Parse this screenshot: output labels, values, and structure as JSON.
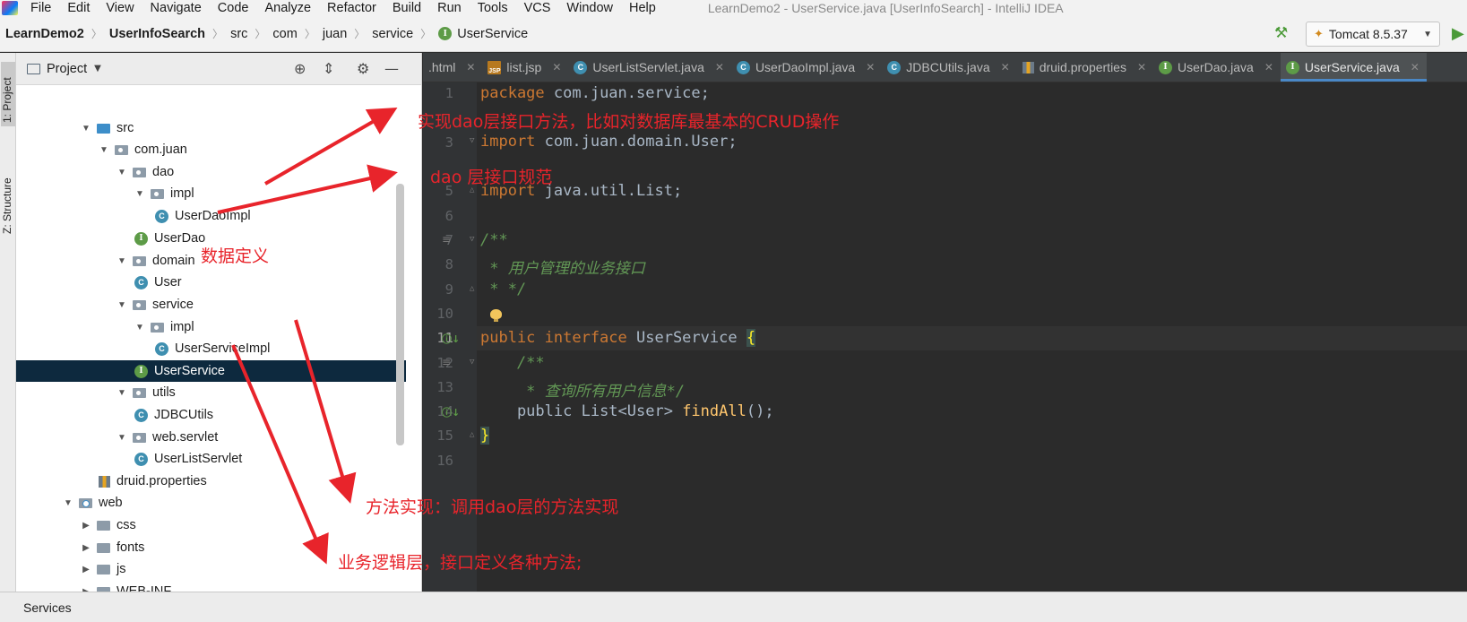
{
  "window": {
    "title": "LearnDemo2 - UserService.java [UserInfoSearch] - IntelliJ IDEA",
    "menu": [
      "File",
      "Edit",
      "View",
      "Navigate",
      "Code",
      "Analyze",
      "Refactor",
      "Build",
      "Run",
      "Tools",
      "VCS",
      "Window",
      "Help"
    ]
  },
  "navbar": {
    "breadcrumbs": [
      "LearnDemo2",
      "UserInfoSearch",
      "src",
      "com",
      "juan",
      "service",
      "UserService"
    ],
    "run_config": "Tomcat 8.5.37"
  },
  "left_strip": {
    "project_tab": "1: Project",
    "structure_tab": "Z: Structure"
  },
  "project_panel": {
    "title": "Project",
    "tree": [
      {
        "label": "src",
        "icon": "src-folder-icon",
        "twisty": "expanded"
      },
      {
        "label": "com.juan",
        "icon": "package-icon",
        "twisty": "expanded"
      },
      {
        "label": "dao",
        "icon": "package-icon",
        "twisty": "expanded"
      },
      {
        "label": "impl",
        "icon": "package-icon",
        "twisty": "expanded"
      },
      {
        "label": "UserDaoImpl",
        "icon": "class-icon",
        "twisty": "none"
      },
      {
        "label": "UserDao",
        "icon": "interface-icon",
        "twisty": "none"
      },
      {
        "label": "domain",
        "icon": "package-icon",
        "twisty": "expanded"
      },
      {
        "label": "User",
        "icon": "class-icon",
        "twisty": "none"
      },
      {
        "label": "service",
        "icon": "package-icon",
        "twisty": "expanded"
      },
      {
        "label": "impl",
        "icon": "package-icon",
        "twisty": "expanded"
      },
      {
        "label": "UserServiceImpl",
        "icon": "class-icon",
        "twisty": "none"
      },
      {
        "label": "UserService",
        "icon": "interface-icon",
        "twisty": "none",
        "selected": true
      },
      {
        "label": "utils",
        "icon": "package-icon",
        "twisty": "expanded"
      },
      {
        "label": "JDBCUtils",
        "icon": "class-icon",
        "twisty": "none"
      },
      {
        "label": "web.servlet",
        "icon": "package-icon",
        "twisty": "expanded"
      },
      {
        "label": "UserListServlet",
        "icon": "class-icon",
        "twisty": "none"
      },
      {
        "label": "druid.properties",
        "icon": "properties-icon",
        "twisty": "none"
      },
      {
        "label": "web",
        "icon": "web-folder-icon",
        "twisty": "expanded"
      },
      {
        "label": "css",
        "icon": "folder-icon",
        "twisty": "collapsed"
      },
      {
        "label": "fonts",
        "icon": "folder-icon",
        "twisty": "collapsed"
      },
      {
        "label": "js",
        "icon": "folder-icon",
        "twisty": "collapsed"
      },
      {
        "label": "WEB-INF",
        "icon": "folder-icon",
        "twisty": "collapsed"
      }
    ]
  },
  "editor": {
    "tabs": [
      {
        "label": ".html",
        "icon": "none"
      },
      {
        "label": "list.jsp",
        "icon": "jsp-icon"
      },
      {
        "label": "UserListServlet.java",
        "icon": "class-icon"
      },
      {
        "label": "UserDaoImpl.java",
        "icon": "class-icon"
      },
      {
        "label": "JDBCUtils.java",
        "icon": "class-icon"
      },
      {
        "label": "druid.properties",
        "icon": "properties-icon"
      },
      {
        "label": "UserDao.java",
        "icon": "interface-icon"
      },
      {
        "label": "UserService.java",
        "icon": "interface-icon",
        "active": true
      }
    ],
    "line_numbers": [
      "1",
      "3",
      "5",
      "6",
      "7",
      "8",
      "9",
      "10",
      "11",
      "12",
      "13",
      "14",
      "15",
      "16"
    ],
    "current_line": "11",
    "code": {
      "l1_kw": "package",
      "l1_rest": " com.juan.service;",
      "l3_kw": "import",
      "l3_rest": " com.juan.domain.User;",
      "l5_kw": "import",
      "l5_rest": " java.util.List;",
      "l7": "/**",
      "l8": " * 用户管理的业务接口",
      "l9": " * */",
      "l11_kw": "public interface",
      "l11_name": " UserService ",
      "l11_brace": "{",
      "l12": "    /**",
      "l13": "     * 查询所有用户信息*/",
      "l14_kw": "    public",
      "l14_type": " List<User> ",
      "l14_fn": "findAll",
      "l14_end": "();",
      "l15": "}"
    }
  },
  "bottom_bar": {
    "services": "Services"
  },
  "annotations": {
    "dao_impl": "实现dao层接口方法，比如对数据库最基本的CRUD操作",
    "dao_spec": "dao 层接口规范",
    "data_def": "数据定义",
    "method_impl": "方法实现：调用dao层的方法实现",
    "business": "业务逻辑层，接口定义各种方法;"
  },
  "colors": {
    "annotation_red": "#e8242b",
    "selection": "#0d293e",
    "keyword": "#cc7832",
    "comment": "#629755",
    "function": "#ffc66d"
  }
}
